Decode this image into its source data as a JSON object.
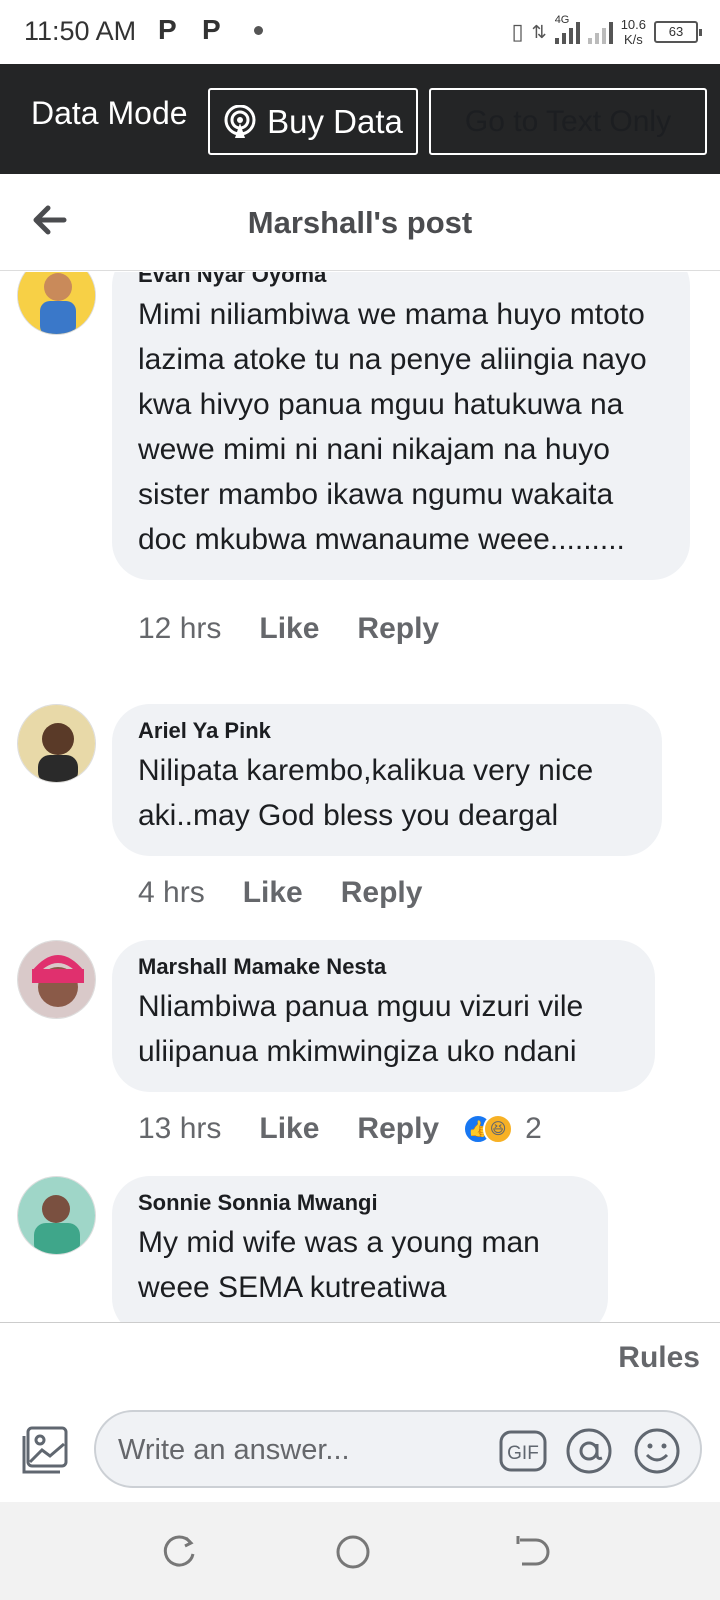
{
  "status_bar": {
    "time": "11:50 AM",
    "notif_icons": [
      "P",
      "P"
    ],
    "network_type": "4G",
    "speed_value": "10.6",
    "speed_unit": "K/s",
    "battery": "63"
  },
  "data_bar": {
    "mode_label": "Data Mode",
    "buy_data_label": "Buy Data",
    "text_only_label": "Go to Text Only",
    "background": "#242526"
  },
  "header": {
    "title": "Marshall's post"
  },
  "comments": [
    {
      "author": "Evan Nyar Oyoma",
      "text": "Mimi niliambiwa we mama huyo mtoto lazima atoke tu na penye aliingia nayo kwa hivyo panua mguu hatukuwa na wewe mimi ni nani nikajam na huyo sister mambo ikawa ngumu wakaita doc mkubwa mwanaume weee.........",
      "time": "12 hrs",
      "like": "Like",
      "reply": "Reply"
    },
    {
      "author": "Ariel Ya Pink",
      "text": "Nilipata karembo,kalikua very nice aki..may God bless you deargal",
      "time": "4 hrs",
      "like": "Like",
      "reply": "Reply"
    },
    {
      "author": "Marshall Mamake Nesta",
      "text": "Nliambiwa panua mguu vizuri vile uliipanua mkimwingiza uko ndani",
      "time": "13 hrs",
      "like": "Like",
      "reply": "Reply",
      "reactions": [
        "like",
        "haha"
      ],
      "reaction_count": "2"
    },
    {
      "author": "Sonnie Sonnia Mwangi",
      "text": "My mid wife was a young man weee SEMA kutreatiwa"
    }
  ],
  "footer": {
    "rules_label": "Rules",
    "composer_placeholder": "Write an answer...",
    "gif_label": "GIF"
  },
  "colors": {
    "accent_blue": "#1877f2",
    "bubble_bg": "#f0f2f5",
    "secondary_text": "#65676b"
  }
}
